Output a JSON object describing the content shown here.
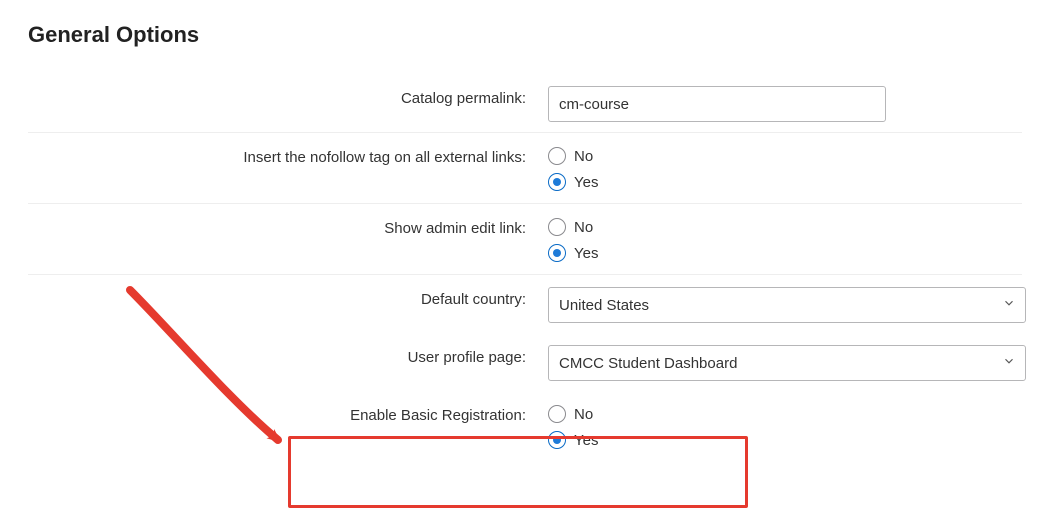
{
  "heading": "General Options",
  "fields": {
    "permalink": {
      "label": "Catalog permalink:",
      "value": "cm-course"
    },
    "nofollow": {
      "label": "Insert the nofollow tag on all external links:",
      "no": "No",
      "yes": "Yes",
      "selected": "yes"
    },
    "adminlink": {
      "label": "Show admin edit link:",
      "no": "No",
      "yes": "Yes",
      "selected": "yes"
    },
    "country": {
      "label": "Default country:",
      "value": "United States"
    },
    "profile": {
      "label": "User profile page:",
      "value": "CMCC Student Dashboard"
    },
    "basicreg": {
      "label": "Enable Basic Registration:",
      "no": "No",
      "yes": "Yes",
      "selected": "yes"
    }
  }
}
